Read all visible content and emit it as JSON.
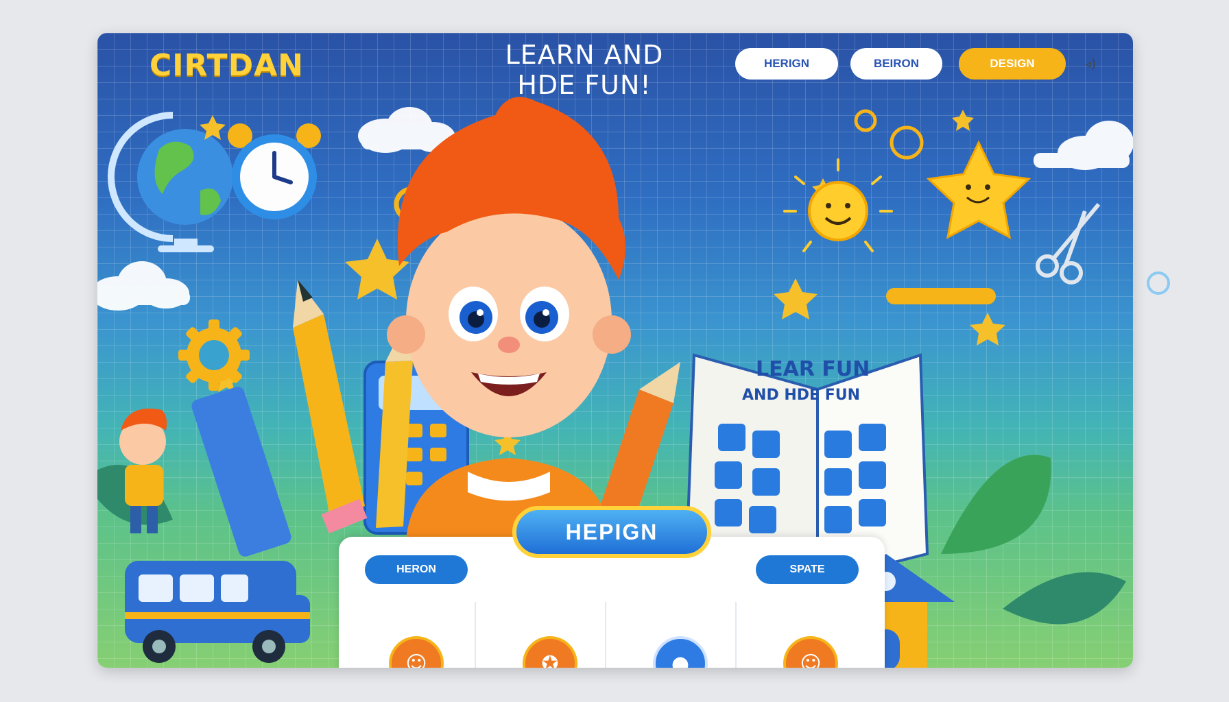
{
  "brand": {
    "logo_text": "CIRTDAN"
  },
  "hero": {
    "headline_line1": "LEARN AND",
    "headline_line2": "HDE FUN!"
  },
  "nav": {
    "items": [
      "HERIGN",
      "BEIRON",
      "DESIGN"
    ]
  },
  "cta": {
    "label": "HEPIGN"
  },
  "panel": {
    "left_pill": "HERON",
    "right_pill": "SPATE"
  },
  "book": {
    "title_line1": "LEAR FUN",
    "title_line2": "AND HDE FUN"
  },
  "colors": {
    "accent": "#ffd23a",
    "primary": "#1f78d6",
    "orange": "#f07a22"
  },
  "icons": [
    "globe-icon",
    "alarm-clock-icon",
    "sun-icon",
    "star-icon",
    "scissors-icon",
    "gear-icon",
    "calculator-icon",
    "pencil-icon",
    "book-icon",
    "bus-icon",
    "house-icon",
    "speaker-icon"
  ]
}
